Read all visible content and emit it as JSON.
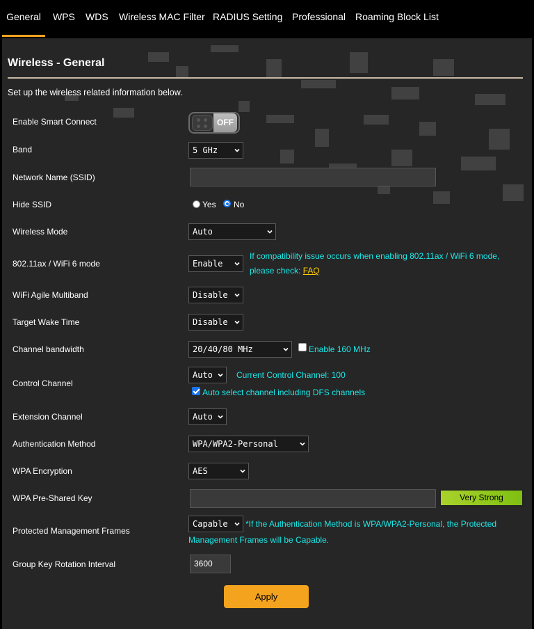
{
  "tabs": [
    {
      "label": "General",
      "active": true
    },
    {
      "label": "WPS"
    },
    {
      "label": "WDS"
    },
    {
      "label": "Wireless MAC Filter"
    },
    {
      "label": "RADIUS Setting"
    },
    {
      "label": "Professional"
    },
    {
      "label": "Roaming Block List"
    }
  ],
  "page": {
    "title": "Wireless - General",
    "description": "Set up the wireless related information below."
  },
  "fields": {
    "smart_connect": {
      "label": "Enable Smart Connect",
      "state": "OFF"
    },
    "band": {
      "label": "Band",
      "value": "5 GHz"
    },
    "ssid": {
      "label": "Network Name (SSID)",
      "value": ""
    },
    "hide_ssid": {
      "label": "Hide SSID",
      "yes": "Yes",
      "no": "No"
    },
    "wireless_mode": {
      "label": "Wireless Mode",
      "value": "Auto"
    },
    "wifi6": {
      "label": "802.11ax / WiFi 6 mode",
      "value": "Enable",
      "note_line1": "If compatibility issue occurs when enabling 802.11ax / WiFi 6 mode,",
      "note_line2": "please check: ",
      "faq": "FAQ"
    },
    "agile_multiband": {
      "label": "WiFi Agile Multiband",
      "value": "Disable"
    },
    "target_wake": {
      "label": "Target Wake Time",
      "value": "Disable"
    },
    "bandwidth": {
      "label": "Channel bandwidth",
      "value": "20/40/80 MHz",
      "enable160": "Enable 160 MHz"
    },
    "control_channel": {
      "label": "Control Channel",
      "value": "Auto",
      "current": "Current Control Channel: 100",
      "dfs": "Auto select channel including DFS channels"
    },
    "extension_channel": {
      "label": "Extension Channel",
      "value": "Auto"
    },
    "auth_method": {
      "label": "Authentication Method",
      "value": "WPA/WPA2-Personal"
    },
    "wpa_encryption": {
      "label": "WPA Encryption",
      "value": "AES"
    },
    "psk": {
      "label": "WPA Pre-Shared Key",
      "value": "",
      "strength": "Very Strong"
    },
    "pmf": {
      "label": "Protected Management Frames",
      "value": "Capable",
      "note_line1": "*If the Authentication Method is WPA/WPA2-Personal, the Protected",
      "note_line2": "Management Frames will be Capable."
    },
    "group_key": {
      "label": "Group Key Rotation Interval",
      "value": "3600"
    }
  },
  "apply_label": "Apply",
  "colors": {
    "accent": "#f4a31e",
    "note": "#1ce9e9",
    "faq": "#ffcc00",
    "strength": "#9fd11f"
  }
}
